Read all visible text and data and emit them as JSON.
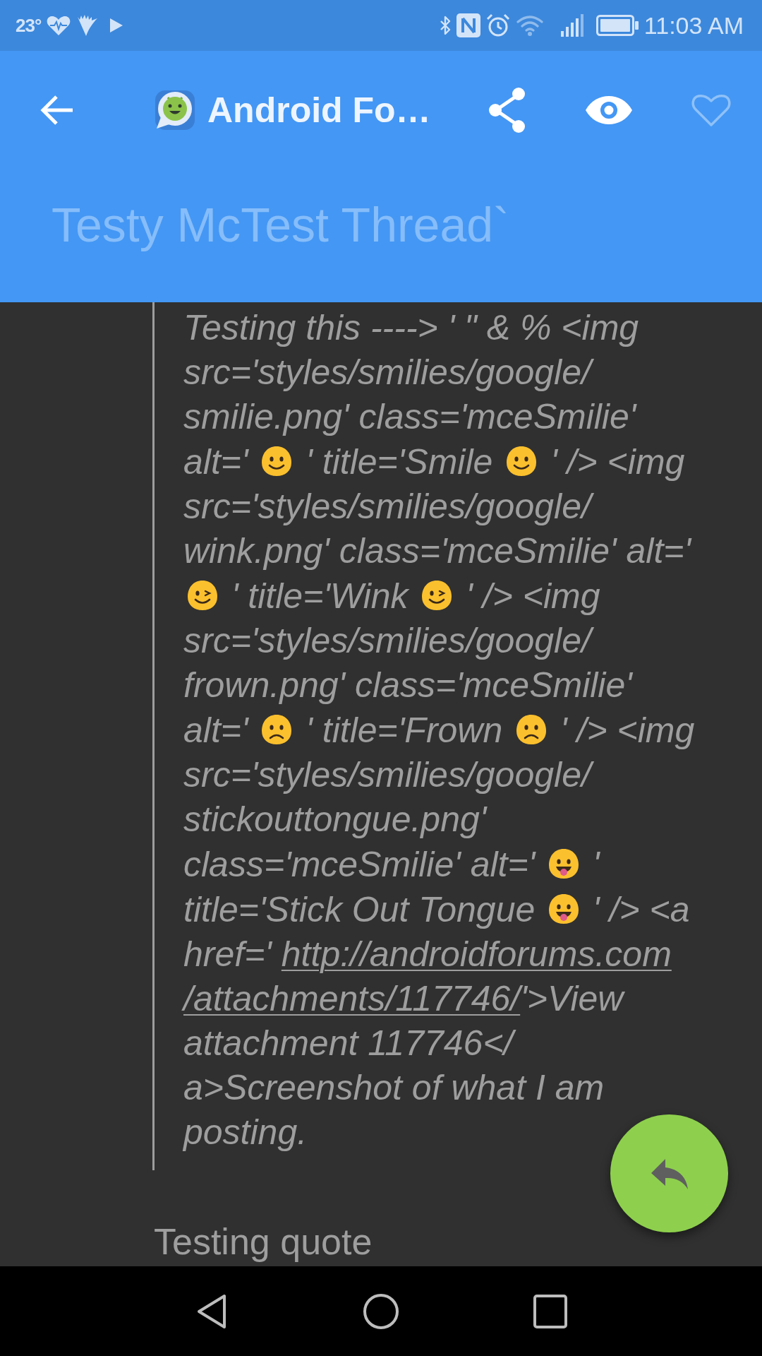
{
  "status_bar": {
    "temperature": "23°",
    "time": "11:03 AM"
  },
  "app_bar": {
    "title": "Android Fo…",
    "favorited": false,
    "thread_title": "Testy McTest Thread`"
  },
  "post": {
    "quote": {
      "segments": [
        {
          "kind": "text",
          "text": "Testing this ----> ' \" & % <img src='styles/smilies/google/smilie.png' class='mceSmilie' alt=' "
        },
        {
          "kind": "smile"
        },
        {
          "kind": "text",
          "text": " ' title='Smile "
        },
        {
          "kind": "smile"
        },
        {
          "kind": "text",
          "text": " ' /> <img src='styles/smilies/google/wink.png' class='mceSmilie' alt=' "
        },
        {
          "kind": "wink"
        },
        {
          "kind": "text",
          "text": " ' title='Wink "
        },
        {
          "kind": "wink"
        },
        {
          "kind": "text",
          "text": " ' /> <img src='styles/smilies/google/frown.png' class='mceSmilie' alt=' "
        },
        {
          "kind": "frown"
        },
        {
          "kind": "text",
          "text": " ' title='Frown "
        },
        {
          "kind": "frown"
        },
        {
          "kind": "text",
          "text": " ' /> <img src='styles/smilies/google/stickouttongue.png' class='mceSmilie' alt=' "
        },
        {
          "kind": "tongue"
        },
        {
          "kind": "text",
          "text": " ' title='Stick Out Tongue "
        },
        {
          "kind": "tongue"
        },
        {
          "kind": "text",
          "text": " ' /> <a href=' "
        },
        {
          "kind": "link",
          "text": "http://androidforums.com"
        },
        {
          "kind": "link",
          "text": "/attachments/117746/"
        },
        {
          "kind": "text",
          "text": "'>View attachment 117746</a>Screenshot of what I am posting."
        }
      ]
    },
    "text": "Testing quote"
  }
}
